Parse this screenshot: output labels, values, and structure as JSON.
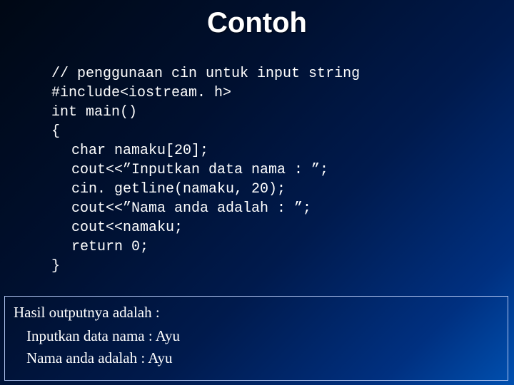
{
  "title": "Contoh",
  "code": {
    "l1": "// penggunaan cin untuk input string",
    "l2": "#include<iostream. h>",
    "l3": "int main()",
    "l4": "{",
    "l5": "char namaku[20];",
    "l6": "cout<<”Inputkan data nama : ”;",
    "l7": "cin. getline(namaku, 20);",
    "l8": "cout<<”Nama anda adalah : ”;",
    "l9": "cout<<namaku;",
    "l10": "return 0;",
    "l11": "}"
  },
  "output": {
    "header": "Hasil outputnya adalah :",
    "line1": "Inputkan data nama : Ayu",
    "line2": "Nama anda adalah : Ayu"
  }
}
